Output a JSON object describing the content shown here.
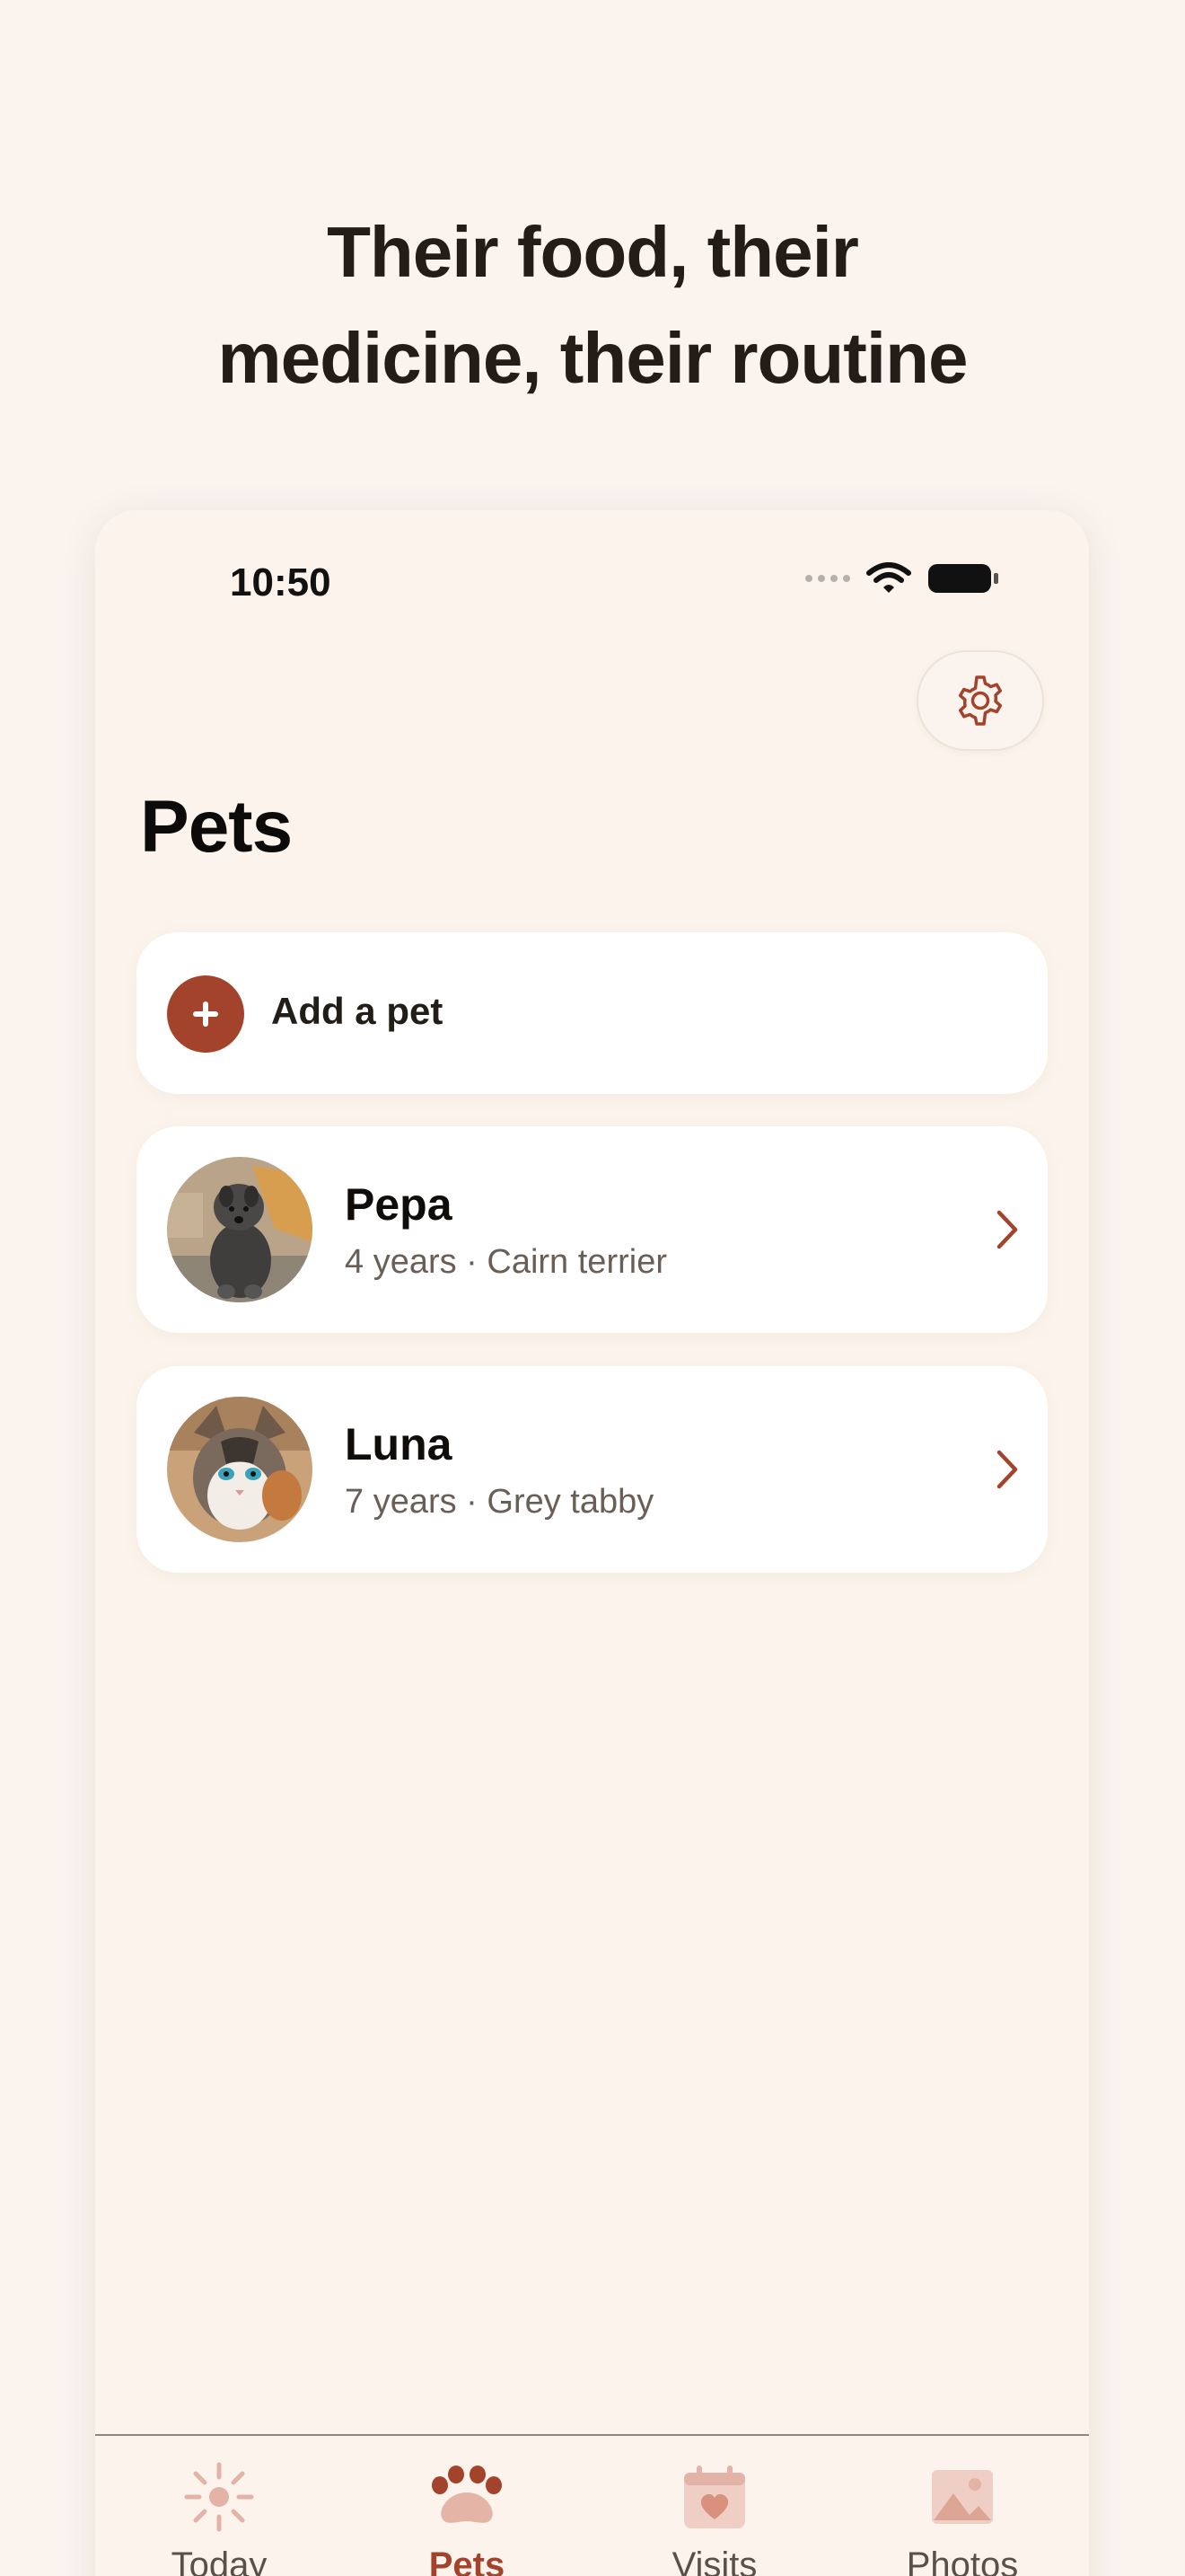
{
  "headline": {
    "line1": "Their food, their",
    "line2": "medicine, their routine"
  },
  "status_bar": {
    "time": "10:50"
  },
  "page": {
    "title": "Pets"
  },
  "add_pet": {
    "label": "Add a pet"
  },
  "pets": [
    {
      "name": "Pepa",
      "meta": "4 years · Cairn terrier",
      "avatar_icon": "dog-photo"
    },
    {
      "name": "Luna",
      "meta": "7 years · Grey tabby",
      "avatar_icon": "cat-photo"
    }
  ],
  "tabs": [
    {
      "label": "Today",
      "icon": "sun-icon",
      "active": false
    },
    {
      "label": "Pets",
      "icon": "paw-icon",
      "active": true
    },
    {
      "label": "Visits",
      "icon": "calendar-heart-icon",
      "active": false
    },
    {
      "label": "Photos",
      "icon": "image-icon",
      "active": false
    }
  ],
  "colors": {
    "accent": "#a3432b",
    "background": "#faf3ee",
    "card": "#ffffff",
    "muted_icon": "#e2b3a6"
  }
}
